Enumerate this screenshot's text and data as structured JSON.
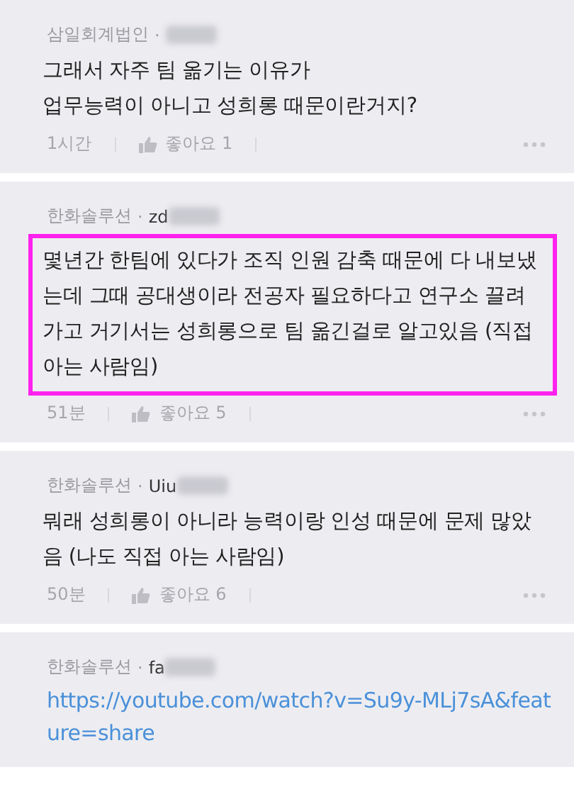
{
  "comments": [
    {
      "company": "삼일회계법인",
      "separator": "·",
      "redacted": true,
      "highlighted": false,
      "kind": "text",
      "body": "그래서 자주 팀 옮기는 이유가\n업무능력이 아니고 성희롱 때문이란거지?",
      "time": "1시간",
      "likes": "좋아요 1"
    },
    {
      "company": "한화솔루션",
      "separator": "·",
      "user": "zd",
      "redacted": true,
      "highlighted": true,
      "kind": "text",
      "body": "몇년간 한팀에 있다가 조직 인원 감축 때문에 다 내보냈는데 그때 공대생이라 전공자 필요하다고 연구소 끌려가고 거기서는 성희롱으로 팀 옮긴걸로 알고있음 (직접 아는 사람임)",
      "time": "51분",
      "likes": "좋아요 5"
    },
    {
      "company": "한화솔루션",
      "separator": "·",
      "user": "Uiu",
      "redacted": true,
      "highlighted": false,
      "kind": "text",
      "body": "뭐래 성희롱이 아니라 능력이랑 인성 때문에 문제 많았음 (나도 직접 아는 사람임)",
      "time": "50분",
      "likes": "좋아요 6"
    },
    {
      "company": "한화솔루션",
      "separator": "·",
      "user": "fa",
      "redacted": true,
      "kind": "link",
      "body": "https://youtube.com/watch?v=Su9y-MLj7sA&feature=share"
    }
  ]
}
